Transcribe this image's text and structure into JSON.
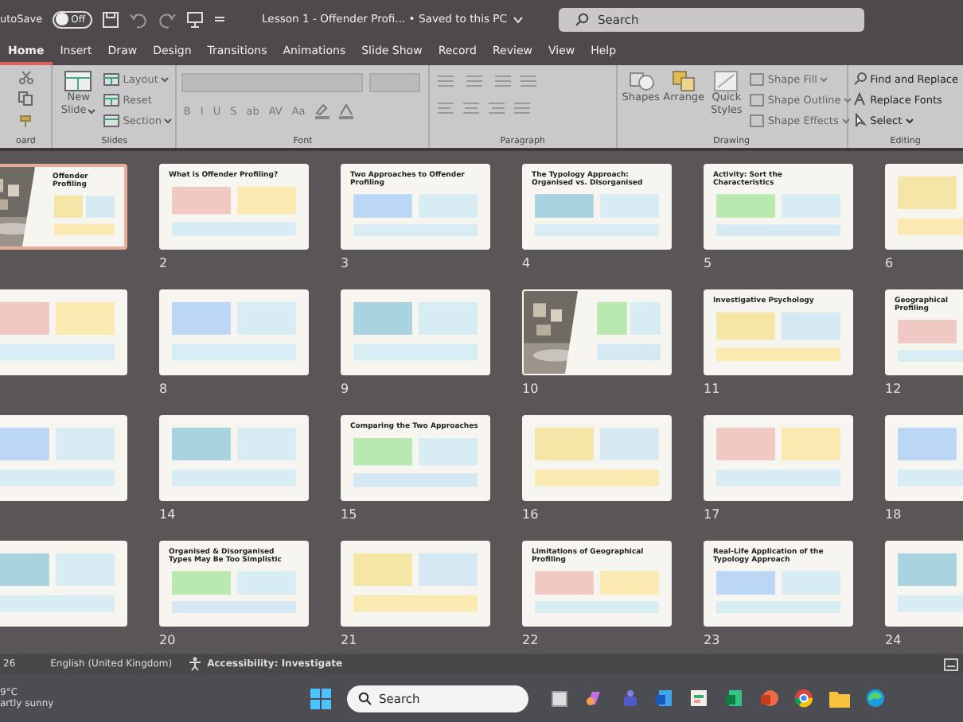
{
  "window": {
    "autosave_label": "utoSave",
    "autosave": {
      "on": false,
      "label": "Off"
    },
    "title": "Lesson 1 - Offender Profi... • Saved to this PC"
  },
  "search": {
    "placeholder": "Search"
  },
  "tabs": [
    {
      "label": "Home",
      "selected": true
    },
    {
      "label": "Insert",
      "selected": false
    },
    {
      "label": "Draw",
      "selected": false
    },
    {
      "label": "Design",
      "selected": false
    },
    {
      "label": "Transitions",
      "selected": false
    },
    {
      "label": "Animations",
      "selected": false
    },
    {
      "label": "Slide Show",
      "selected": false
    },
    {
      "label": "Record",
      "selected": false
    },
    {
      "label": "Review",
      "selected": false
    },
    {
      "label": "View",
      "selected": false
    },
    {
      "label": "Help",
      "selected": false
    }
  ],
  "ribbon": {
    "clipboard": {
      "label": "oard"
    },
    "slides": {
      "label": "Slides",
      "new_slide": [
        "New",
        "Slide"
      ],
      "buttons": [
        "Layout",
        "Reset",
        "Section"
      ]
    },
    "font": {
      "label": "Font",
      "glyphs": [
        "B",
        "I",
        "U",
        "S",
        "ab",
        "AV",
        "Aa"
      ]
    },
    "paragraph": {
      "label": "Paragraph"
    },
    "drawing": {
      "label": "Drawing",
      "big": [
        "Shapes",
        "Arrange",
        "Quick Styles"
      ],
      "buttons": [
        "Shape Fill",
        "Shape Outline",
        "Shape Effects"
      ]
    },
    "editing": {
      "label": "Editing",
      "buttons": [
        "Find and Replace",
        "Replace Fonts",
        "Select"
      ]
    }
  },
  "slides": [
    {
      "title": "Offender Profiling",
      "selected": true
    },
    {
      "kind": "text",
      "number": "2",
      "title": "What is Offender Profiling?",
      "selected": false
    },
    {
      "kind": "text",
      "number": "3",
      "title": "Two Approaches to Offender Profiling",
      "selected": false
    },
    {
      "kind": "text",
      "number": "4",
      "title": "The Typology Approach: Organised vs. Disorganised",
      "selected": false
    },
    {
      "kind": "text",
      "number": "5",
      "title": "Activity: Sort the Characteristics",
      "selected": false
    },
    {
      "kind": "text",
      "number": "6",
      "selected": false
    },
    {
      "kind": "text",
      "selected": false
    },
    {
      "kind": "text",
      "number": "8",
      "selected": false
    },
    {
      "kind": "text",
      "number": "9",
      "selected": false
    },
    {
      "number": "10",
      "selected": false
    },
    {
      "kind": "text",
      "number": "11",
      "title": "Investigative Psychology",
      "selected": false
    },
    {
      "kind": "text",
      "number": "12",
      "title": "Geographical Profiling",
      "selected": false
    },
    {
      "kind": "text",
      "selected": false
    },
    {
      "kind": "text",
      "number": "14",
      "selected": false
    },
    {
      "kind": "text",
      "number": "15",
      "title": "Comparing the Two Approaches",
      "selected": false
    },
    {
      "kind": "text",
      "number": "16",
      "selected": false
    },
    {
      "kind": "text",
      "number": "17",
      "selected": false
    },
    {
      "kind": "text",
      "number": "18",
      "selected": false
    },
    {
      "kind": "text",
      "selected": false
    },
    {
      "kind": "text",
      "number": "20",
      "title": "Organised & Disorganised Types May Be Too Simplistic",
      "selected": false
    },
    {
      "kind": "text",
      "number": "21",
      "selected": false
    },
    {
      "kind": "text",
      "number": "22",
      "title": "Limitations of Geographical Profiling",
      "selected": false
    },
    {
      "kind": "text",
      "number": "23",
      "title": "Real-Life Application of the Typology Approach",
      "selected": false
    },
    {
      "kind": "text",
      "number": "24",
      "selected": false
    }
  ],
  "status_bar": {
    "slide_count": "26",
    "language": "English (United Kingdom)",
    "accessibility": "Accessibility: Investigate"
  },
  "taskbar": {
    "temperature": "9°C",
    "weather": "artly sunny",
    "search_placeholder": "Search"
  }
}
